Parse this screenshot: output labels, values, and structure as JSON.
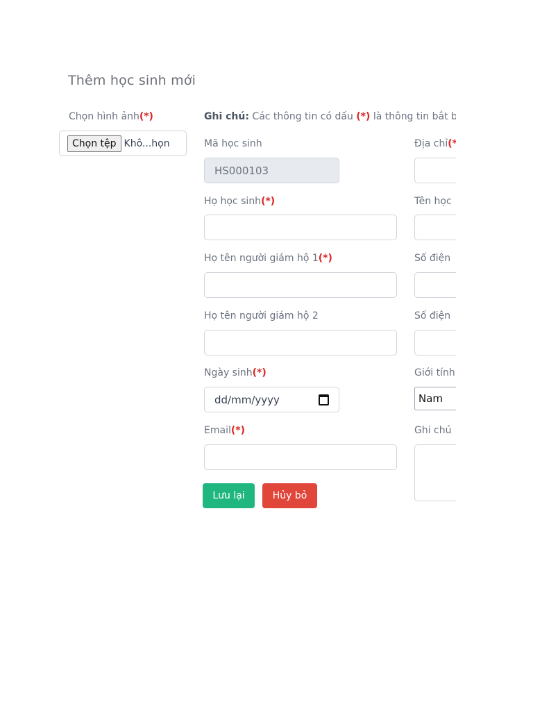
{
  "page": {
    "title": "Thêm học sinh mới"
  },
  "photo": {
    "label": "Chọn hình ảnh",
    "required_mark": "(*)",
    "file_button": "Chọn tệp",
    "file_status": "Khô...họn"
  },
  "note": {
    "prefix": "Ghi chú:",
    "text_before": " Các thông tin có dấu ",
    "mark": "(*)",
    "text_after": " là thông tin bắt b"
  },
  "form": {
    "student_id": {
      "label": "Mã học sinh",
      "value": "HS000103"
    },
    "last_name": {
      "label": "Họ học sinh",
      "required_mark": "(*)",
      "value": ""
    },
    "guardian1": {
      "label": "Họ tên người giám hộ 1",
      "required_mark": "(*)",
      "value": ""
    },
    "guardian2": {
      "label": "Họ tên người giám hộ 2",
      "value": ""
    },
    "birthdate": {
      "label": "Ngày sinh",
      "required_mark": "(*)",
      "placeholder": "dd/mm/yyyy",
      "icon": "calendar-icon"
    },
    "email": {
      "label": "Email",
      "required_mark": "(*)",
      "value": ""
    },
    "address": {
      "label": "Địa chỉ",
      "required_mark": "(*",
      "value": ""
    },
    "first_name": {
      "label": "Tên học",
      "value": ""
    },
    "phone1": {
      "label": "Số điện",
      "value": ""
    },
    "phone2": {
      "label": "Số điện",
      "value": ""
    },
    "gender": {
      "label": "Giới tính",
      "selected": "Nam"
    },
    "notes": {
      "label": "Ghi chú",
      "value": ""
    }
  },
  "actions": {
    "save": "Lưu lại",
    "cancel": "Hủy bỏ"
  },
  "colors": {
    "save": "#1fb77f",
    "cancel": "#e1463a",
    "required": "#dc2626"
  }
}
